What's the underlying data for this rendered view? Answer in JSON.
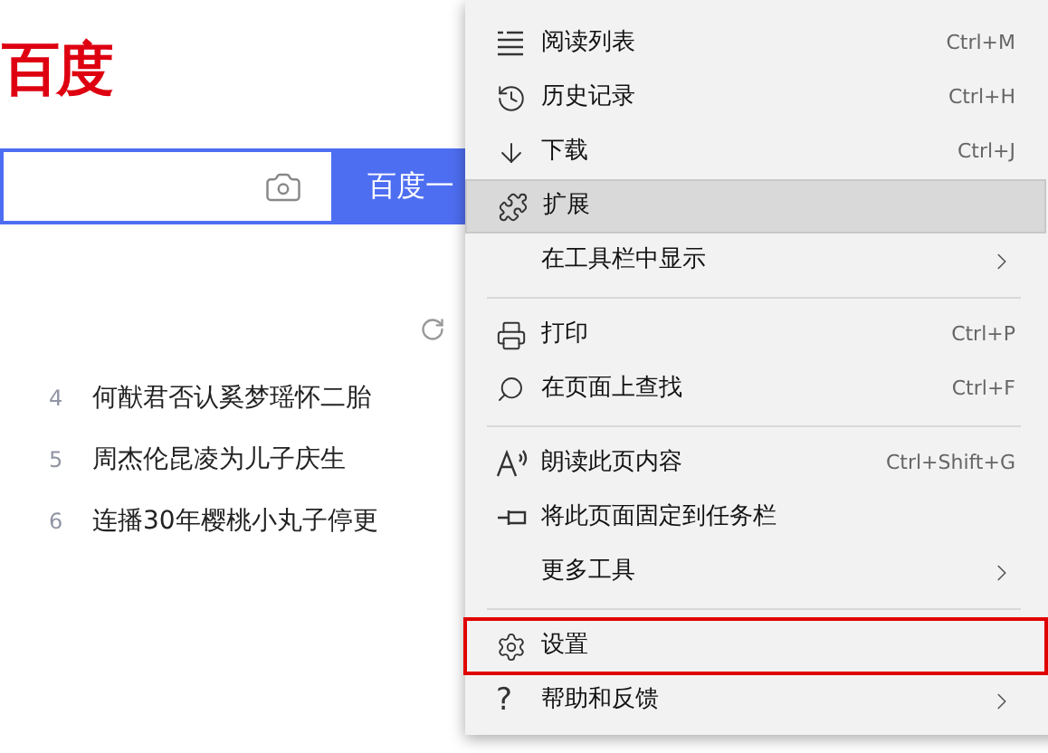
{
  "page": {
    "logo": "百度",
    "search_button": "百度一",
    "hot_list": [
      {
        "rank": "4",
        "title": "何猷君否认奚梦瑶怀二胎"
      },
      {
        "rank": "5",
        "title": "周杰伦昆凌为儿子庆生"
      },
      {
        "rank": "6",
        "title": "连播30年樱桃小丸子停更"
      }
    ]
  },
  "menu": {
    "rows": [
      {
        "kind": "item",
        "label": "阅读列表",
        "shortcut": "Ctrl+M",
        "submenu": false,
        "hovered": false,
        "outlined": false
      },
      {
        "kind": "item",
        "label": "历史记录",
        "shortcut": "Ctrl+H",
        "submenu": false,
        "hovered": false,
        "outlined": false
      },
      {
        "kind": "item",
        "label": "下载",
        "shortcut": "Ctrl+J",
        "submenu": false,
        "hovered": false,
        "outlined": false
      },
      {
        "kind": "item",
        "label": "扩展",
        "submenu": false,
        "hovered": true,
        "outlined": false
      },
      {
        "kind": "item",
        "label": "在工具栏中显示",
        "submenu": true,
        "hovered": false,
        "outlined": false
      },
      {
        "kind": "divider"
      },
      {
        "kind": "item",
        "label": "打印",
        "shortcut": "Ctrl+P",
        "submenu": false,
        "hovered": false,
        "outlined": false
      },
      {
        "kind": "item",
        "label": "在页面上查找",
        "shortcut": "Ctrl+F",
        "submenu": false,
        "hovered": false,
        "outlined": false
      },
      {
        "kind": "divider"
      },
      {
        "kind": "item",
        "label": "朗读此页内容",
        "shortcut": "Ctrl+Shift+G",
        "submenu": false,
        "hovered": false,
        "outlined": false
      },
      {
        "kind": "item",
        "label": "将此页面固定到任务栏",
        "submenu": false,
        "hovered": false,
        "outlined": false
      },
      {
        "kind": "item",
        "label": "更多工具",
        "submenu": true,
        "hovered": false,
        "outlined": false
      },
      {
        "kind": "divider"
      },
      {
        "kind": "item",
        "label": "设置",
        "submenu": false,
        "hovered": false,
        "outlined": true
      },
      {
        "kind": "item",
        "label": "帮助和反馈",
        "icon_text": "?",
        "submenu": true,
        "hovered": false,
        "outlined": false
      }
    ]
  }
}
